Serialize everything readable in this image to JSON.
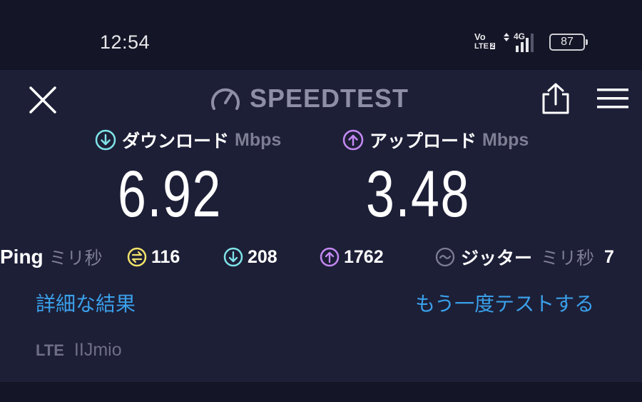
{
  "status_bar": {
    "time": "12:54",
    "volte_top": "Vo",
    "volte_bottom": "LTE",
    "volte_sub": "2",
    "network": "4G",
    "battery": "87"
  },
  "header": {
    "logo_text": "SPEEDTEST",
    "icons": [
      "close-icon",
      "speedometer-icon",
      "share-icon",
      "menu-icon"
    ]
  },
  "download": {
    "label": "ダウンロード",
    "unit": "Mbps",
    "value": "6.92",
    "color": "#7fe3e8"
  },
  "upload": {
    "label": "アップロード",
    "unit": "Mbps",
    "value": "3.48",
    "color": "#c489f2"
  },
  "ping": {
    "label": "Ping",
    "unit": "ミリ秒",
    "idle": "116",
    "download": "208",
    "upload": "1762",
    "idle_color": "#f4e26a"
  },
  "jitter": {
    "label": "ジッター",
    "unit": "ミリ秒",
    "value": "7"
  },
  "links": {
    "details": "詳細な結果",
    "retest": "もう一度テストする"
  },
  "connection": {
    "type": "LTE",
    "provider": "IIJmio"
  }
}
